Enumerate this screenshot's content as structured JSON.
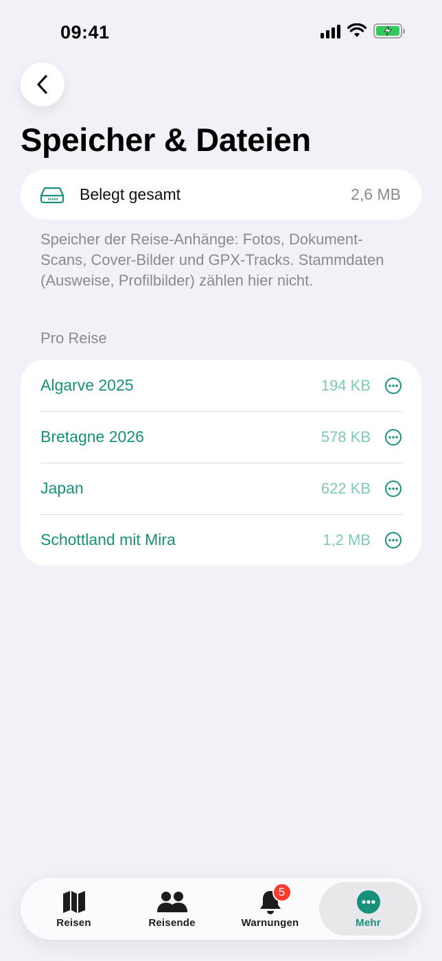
{
  "status_bar": {
    "time": "09:41"
  },
  "header": {
    "title": "Speicher & Dateien"
  },
  "total": {
    "label": "Belegt gesamt",
    "value": "2,6 MB"
  },
  "description": "Speicher der Reise-Anhänge: Fotos, Dokument-Scans, Cover-Bilder und GPX-Tracks. Stammdaten (Ausweise, Profilbilder) zählen hier nicht.",
  "section_label": "Pro Reise",
  "trips": [
    {
      "name": "Algarve 2025",
      "size": "194 KB"
    },
    {
      "name": "Bretagne 2026",
      "size": "578 KB"
    },
    {
      "name": "Japan",
      "size": "622 KB"
    },
    {
      "name": "Schottland mit Mira",
      "size": "1,2 MB"
    }
  ],
  "tabs": [
    {
      "label": "Reisen",
      "icon": "map-icon"
    },
    {
      "label": "Reisende",
      "icon": "people-icon"
    },
    {
      "label": "Warnungen",
      "icon": "bell-icon",
      "badge": "5"
    },
    {
      "label": "Mehr",
      "icon": "more-icon",
      "active": true
    }
  ],
  "colors": {
    "accent": "#16907a",
    "accent_light": "#7cc9b8",
    "badge": "#ff3b30",
    "background": "#f2f1f7"
  }
}
